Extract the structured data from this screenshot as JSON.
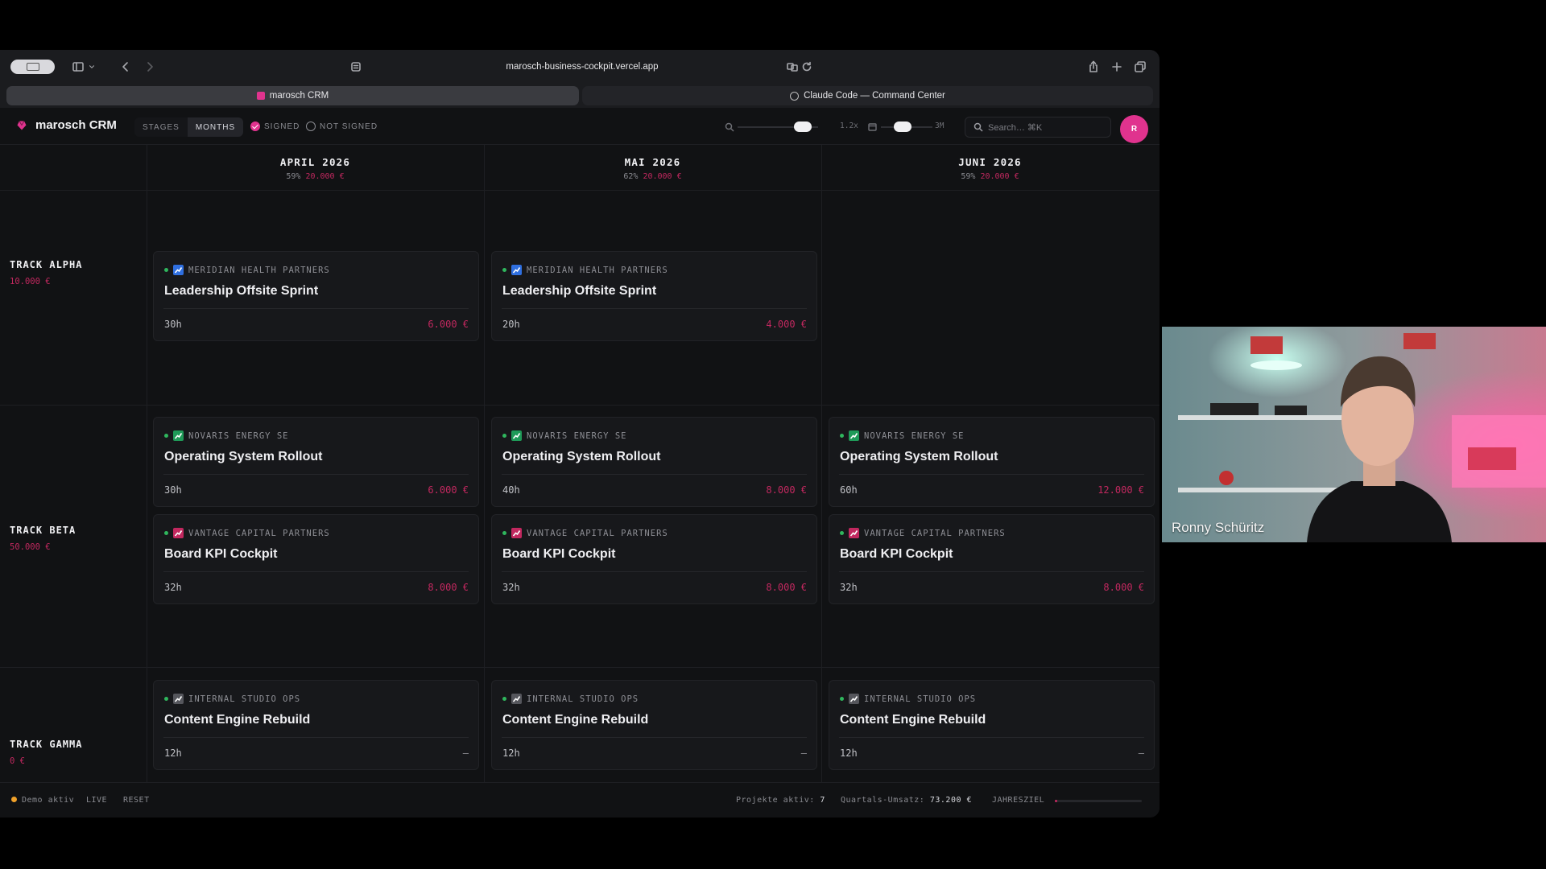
{
  "browser": {
    "url": "marosch-business-cockpit.vercel.app",
    "tabs": [
      {
        "label": "marosch CRM",
        "active": true
      },
      {
        "label": "Claude Code — Command Center",
        "active": false
      }
    ]
  },
  "header": {
    "brand": "marosch CRM",
    "view_toggle": [
      {
        "label": "STAGES",
        "active": false
      },
      {
        "label": "MONTHS",
        "active": true
      }
    ],
    "filters": [
      {
        "label": "SIGNED",
        "checked": true
      },
      {
        "label": "NOT SIGNED",
        "checked": false
      }
    ],
    "zoom": {
      "value_label": "1.2x",
      "range_label": "3M"
    },
    "search_placeholder": "Search… ⌘K",
    "avatar_initial": "R"
  },
  "board": {
    "columns": [
      {
        "title": "APRIL 2026",
        "percent": "59%",
        "amount": "20.000 €"
      },
      {
        "title": "MAI 2026",
        "percent": "62%",
        "amount": "20.000 €"
      },
      {
        "title": "JUNI 2026",
        "percent": "59%",
        "amount": "20.000 €"
      }
    ],
    "tracks": [
      {
        "name": "TRACK ALPHA",
        "amount": "10.000 €"
      },
      {
        "name": "TRACK BETA",
        "amount": "50.000 €"
      },
      {
        "name": "TRACK GAMMA",
        "amount": "0 €"
      }
    ],
    "cards": {
      "alpha": [
        {
          "client": "MERIDIAN HEALTH PARTNERS",
          "title": "Leadership Offsite Sprint",
          "hours": "30h",
          "amount": "6.000 €"
        },
        {
          "client": "MERIDIAN HEALTH PARTNERS",
          "title": "Leadership Offsite Sprint",
          "hours": "20h",
          "amount": "4.000 €"
        }
      ],
      "beta_os": [
        {
          "client": "NOVARIS ENERGY SE",
          "title": "Operating System Rollout",
          "hours": "30h",
          "amount": "6.000 €"
        },
        {
          "client": "NOVARIS ENERGY SE",
          "title": "Operating System Rollout",
          "hours": "40h",
          "amount": "8.000 €"
        },
        {
          "client": "NOVARIS ENERGY SE",
          "title": "Operating System Rollout",
          "hours": "60h",
          "amount": "12.000 €"
        }
      ],
      "beta_kpi": [
        {
          "client": "VANTAGE CAPITAL PARTNERS",
          "title": "Board KPI Cockpit",
          "hours": "32h",
          "amount": "8.000 €"
        },
        {
          "client": "VANTAGE CAPITAL PARTNERS",
          "title": "Board KPI Cockpit",
          "hours": "32h",
          "amount": "8.000 €"
        },
        {
          "client": "VANTAGE CAPITAL PARTNERS",
          "title": "Board KPI Cockpit",
          "hours": "32h",
          "amount": "8.000 €"
        }
      ],
      "gamma": [
        {
          "client": "INTERNAL STUDIO OPS",
          "title": "Content Engine Rebuild",
          "hours": "12h",
          "amount": "–"
        },
        {
          "client": "INTERNAL STUDIO OPS",
          "title": "Content Engine Rebuild",
          "hours": "12h",
          "amount": "–"
        },
        {
          "client": "INTERNAL STUDIO OPS",
          "title": "Content Engine Rebuild",
          "hours": "12h",
          "amount": "–"
        }
      ]
    }
  },
  "statusbar": {
    "demo": "Demo aktiv",
    "live": "LIVE",
    "reset": "RESET",
    "projects_label": "Projekte aktiv:",
    "projects_value": "7",
    "revenue_label": "Quartals-Umsatz:",
    "revenue_value": "73.200 €",
    "goal_label": "JAHRESZIEL",
    "goal_progress": 0.03
  },
  "webcam": {
    "name": "Ronny Schüritz"
  },
  "colors": {
    "accent": "#e0338e",
    "amount": "#c2285f",
    "signed_dot": "#2fb65d",
    "demo_dot": "#f0a12a"
  }
}
